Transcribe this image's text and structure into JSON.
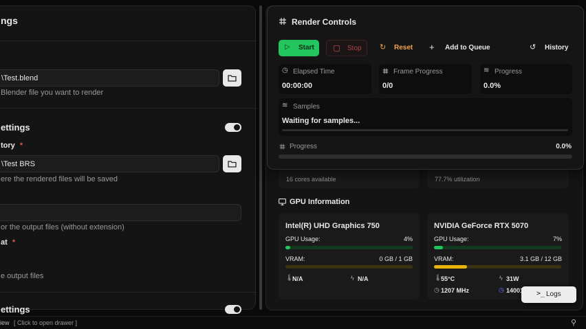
{
  "left_panel": {
    "title": "ngs",
    "blend_file_value": "\\Test.blend",
    "blend_file_help": "Blender file you want to render",
    "output_section_title": "ettings",
    "output_dir_label": "tory",
    "required_mark": "*",
    "output_dir_value": "\\Test BRS",
    "output_dir_help": "ere the rendered files will be saved",
    "filename_help": "or the output files (without extension)",
    "format_label": "at",
    "format_help": "e output files",
    "bottom_section_title": "ettings"
  },
  "render_controls": {
    "title": "Render Controls",
    "start_label": "Start",
    "stop_label": "Stop",
    "reset_label": "Reset",
    "add_queue_label": "Add to Queue",
    "history_label": "History",
    "elapsed_label": "Elapsed Time",
    "elapsed_value": "00:00:00",
    "frame_progress_label": "Frame Progress",
    "frame_progress_value": "0/0",
    "progress_label": "Progress",
    "progress_value": "0.0%",
    "samples_label": "Samples",
    "samples_value": "Waiting for samples...",
    "overall_progress_label": "Progress",
    "overall_progress_value": "0.0%",
    "overall_progress_fraction": 0
  },
  "system": {
    "cpu_cores_text": "16 cores available",
    "utilization_text": "77.7% utilization",
    "gpu_section_title": "GPU Information",
    "gpus": [
      {
        "name": "Intel(R) UHD Graphics 750",
        "usage_label": "GPU Usage:",
        "usage_value": "4%",
        "usage_fraction": 0.04,
        "vram_label": "VRAM:",
        "vram_value": "0 GB / 1 GB",
        "vram_fraction": 0.0,
        "temp": "N/A",
        "power": "N/A"
      },
      {
        "name": "NVIDIA GeForce RTX 5070",
        "usage_label": "GPU Usage:",
        "usage_value": "7%",
        "usage_fraction": 0.07,
        "vram_label": "VRAM:",
        "vram_value": "3.1 GB / 12 GB",
        "vram_fraction": 0.26,
        "temp": "55°C",
        "power": "31W",
        "clock": "1207 MHz",
        "mem_clock": "14001 MHz"
      }
    ]
  },
  "logs_label": "Logs",
  "status_bar": {
    "left_text": "iew",
    "hint": "[ Click to open drawer ]"
  },
  "colors": {
    "accent_green": "#22c55e",
    "stop_red": "#e05555",
    "reset_orange": "#f0a44b",
    "vram_yellow": "#eab308"
  }
}
